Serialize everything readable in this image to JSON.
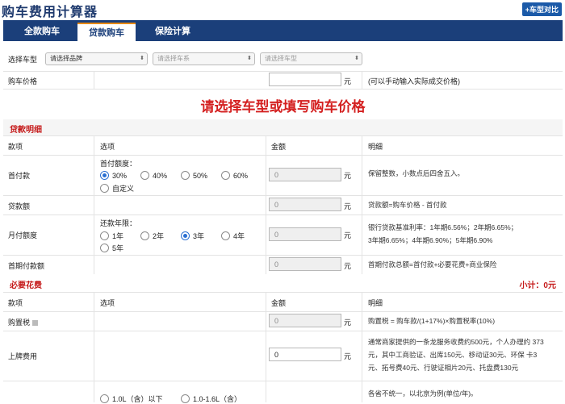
{
  "header": {
    "title": "购车费用计算器",
    "compare_label": "+车型对比"
  },
  "tabs": [
    {
      "label": "全款购车"
    },
    {
      "label": "贷款购车"
    },
    {
      "label": "保险计算"
    }
  ],
  "car_select": {
    "label": "选择车型",
    "brand": "请选择品牌",
    "series": "请选择车系",
    "model": "请选择车型"
  },
  "price": {
    "label": "购车价格",
    "value": "",
    "unit": "元",
    "hint": "(可以手动输入实际成交价格)"
  },
  "prompt": "请选择车型或填写购车价格",
  "loan_section": {
    "title": "贷款明细",
    "columns": [
      "款项",
      "选项",
      "金额",
      "明细"
    ],
    "down_payment": {
      "label": "首付款",
      "option_title": "首付额度：",
      "options": [
        "30%",
        "40%",
        "50%",
        "60%",
        "自定义"
      ],
      "selected": "30%",
      "value": "0",
      "unit": "元",
      "desc": "保留整数，小数点后四舍五入。"
    },
    "loan_amount": {
      "label": "贷款额",
      "value": "0",
      "unit": "元",
      "desc": "贷款额=购车价格 - 首付款"
    },
    "monthly": {
      "label": "月付额度",
      "option_title": "还款年限：",
      "options": [
        "1年",
        "2年",
        "3年",
        "4年",
        "5年"
      ],
      "selected": "3年",
      "value": "0",
      "unit": "元",
      "desc_line1": "银行贷款基准利率：1年期6.56%；2年期6.65%；",
      "desc_line2": "3年期6.65%；4年期6.90%；5年期6.90%"
    },
    "first_month": {
      "label": "首期付款额",
      "value": "0",
      "unit": "元",
      "desc": "首期付款总额=首付款+必要花费+商业保险"
    }
  },
  "necessary_section": {
    "title": "必要花费",
    "subtotal": "小计：0元",
    "columns": [
      "款项",
      "选项",
      "金额",
      "明细"
    ],
    "purchase_tax": {
      "label": "购置税",
      "value": "0",
      "unit": "元",
      "desc": "购置税 = 购车款/(1+17%)×购置税率(10%)"
    },
    "license": {
      "label": "上牌费用",
      "value": "0",
      "unit": "元",
      "desc_line1": "通常商家提供的一条龙服务收费约500元，个人办理约 373",
      "desc_line2": "元，其中工商验证、出库150元、移动证30元、环保 卡3",
      "desc_line3": "元、拓号费40元、行驶证相片20元、托盘费130元"
    },
    "vehicle_tax": {
      "options": [
        "1.0L（含）以下",
        "1.0-1.6L（含）"
      ],
      "desc": "各省不统一，以北京为例(单位/年)。"
    }
  },
  "colors": {
    "nav": "#1b3f7a",
    "accent_red": "#d42020",
    "tab_highlight": "#e88a14",
    "radio_selected": "#2a6fd1"
  }
}
